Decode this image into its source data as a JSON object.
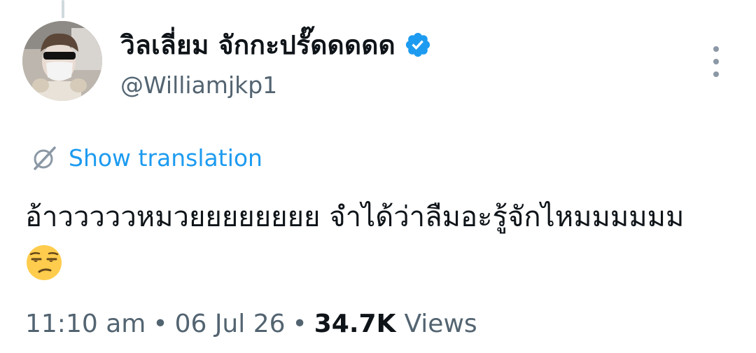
{
  "author": {
    "display_name": "วิลเลี่ยม จักกะปรั๊ดดดดด",
    "handle": "@Williamjkp1",
    "verified": true
  },
  "translate": {
    "label": "Show translation"
  },
  "tweet": {
    "text": "อ้าวววววหมวยยยยยยยย จำได้ว่าลืมอะรู้จักไหมมมมมม",
    "emoji": "unamused-face"
  },
  "meta": {
    "time": "11:10 am",
    "separator": "•",
    "date": "06 Jul 26",
    "views_count": "34.7K",
    "views_label": "Views"
  },
  "colors": {
    "accent": "#1d9bf0",
    "secondary_text": "#536471",
    "primary_text": "#0f1419"
  }
}
